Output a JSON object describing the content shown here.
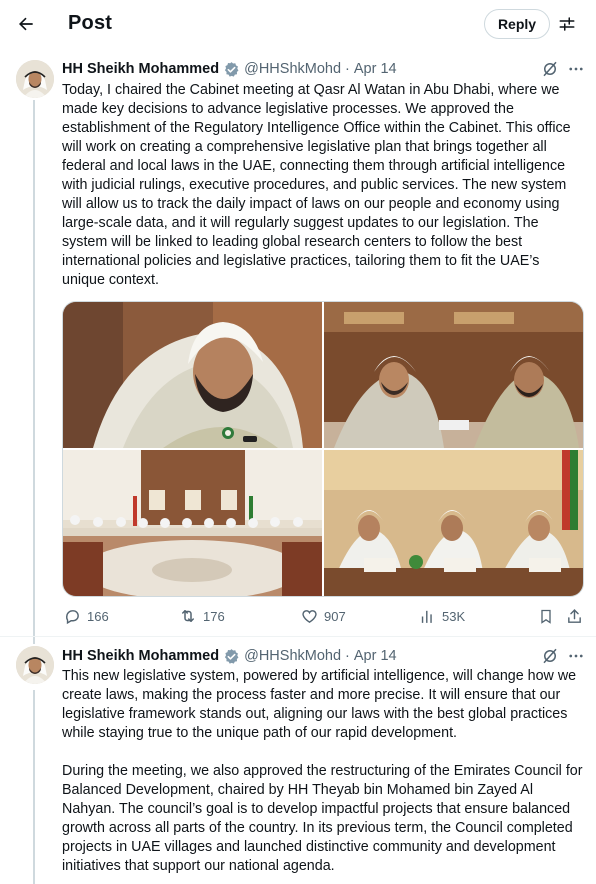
{
  "header": {
    "title": "Post",
    "reply_label": "Reply"
  },
  "posts": [
    {
      "author": {
        "name": "HH Sheikh Mohammed",
        "handle": "@HHShkMohd"
      },
      "date": "Apr 14",
      "text": "Today, I chaired the Cabinet meeting at Qasr Al Watan in Abu Dhabi, where we made key decisions to advance legislative processes. We approved the establishment of the Regulatory Intelligence Office within the Cabinet. This office will work on creating a comprehensive legislative plan that brings together all federal and local laws in the UAE, connecting them through artificial intelligence with judicial rulings, executive procedures, and public services. The new system will allow us to track the daily impact of laws on our people and economy using large-scale data, and it will regularly suggest updates to our legislation. The system will be linked to leading global research centers to follow the best international policies and legislative practices, tailoring them to fit the UAE’s unique context.",
      "stats": {
        "replies": "166",
        "reposts": "176",
        "likes": "907",
        "views": "53K"
      }
    },
    {
      "author": {
        "name": "HH Sheikh Mohammed",
        "handle": "@HHShkMohd"
      },
      "date": "Apr 14",
      "text": "This new legislative system, powered by artificial intelligence, will change how we create laws, making the process faster and more precise. It will ensure that our legislative framework stands out, aligning our laws with the best global practices while staying true to the unique path of our rapid development.\n\nDuring the meeting, we also approved the restructuring of the Emirates Council for Balanced Development, chaired by HH Theyab bin Mohamed bin Zayed Al Nahyan. The council’s goal is to develop impactful projects that ensure balanced growth across all parts of the country. In its previous term, the Council completed projects in UAE villages and launched distinctive community and development initiatives that support our national agenda."
    }
  ],
  "colors": {
    "accent": "#1d9bf0",
    "muted": "#536471",
    "verified": "#829aab"
  }
}
